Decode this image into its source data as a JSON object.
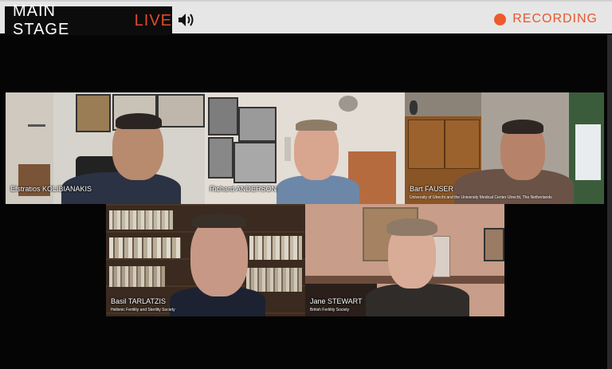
{
  "header": {
    "stage_name": "MAIN STAGE",
    "live_label": "LIVE",
    "recording_label": "RECORDING",
    "speaker_icon": "speaker-volume-icon",
    "recording_icon": "red-dot-icon"
  },
  "colors": {
    "live": "#e2492c",
    "recording": "#ee5a2c",
    "header_bg": "#e6e6e6",
    "stage_bg": "#050505"
  },
  "participants": [
    {
      "name": "Efstratios KOLIBIANAKIS",
      "affiliation": ""
    },
    {
      "name": "Richard ANDERSON",
      "affiliation": ""
    },
    {
      "name": "Bart FAUSER",
      "affiliation": "University of Utrecht and the University Medical Center Utrecht, The Netherlands"
    },
    {
      "name": "Basil TARLATZIS",
      "affiliation": "Hellenic Fertility and Sterility Society"
    },
    {
      "name": "Jane STEWART",
      "affiliation": "British Fertility Society"
    }
  ]
}
